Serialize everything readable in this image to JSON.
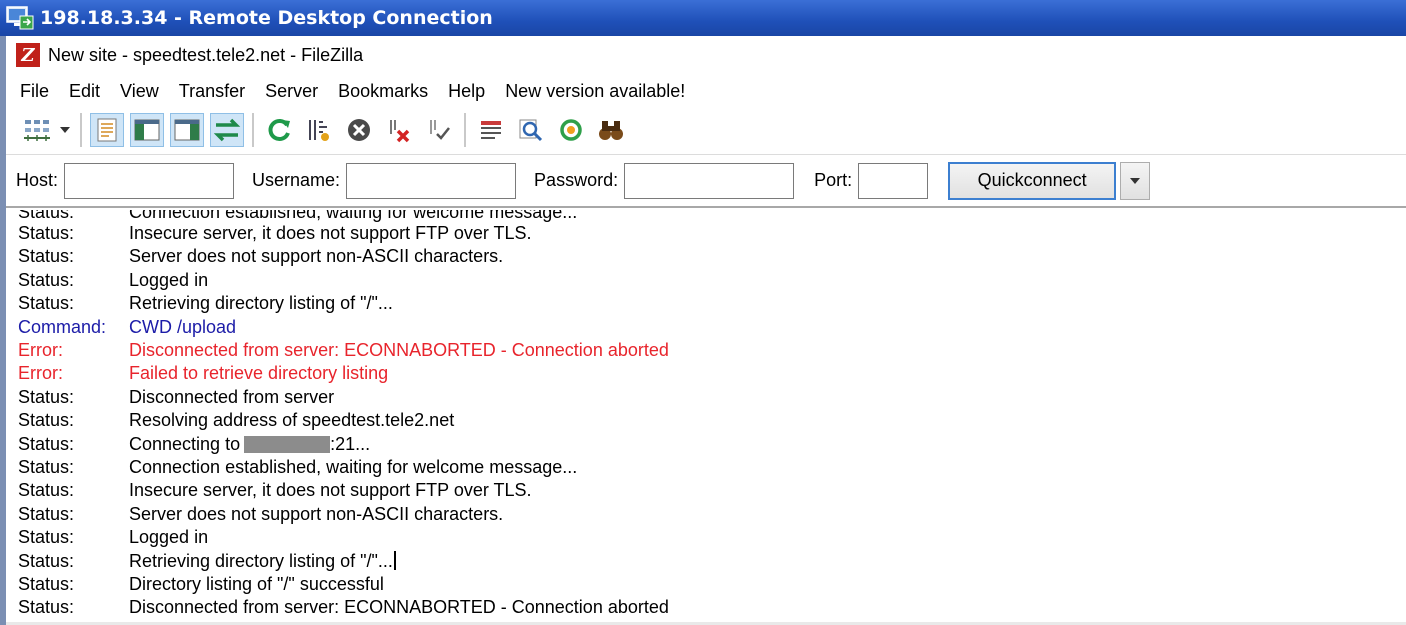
{
  "rdp": {
    "title": "198.18.3.34 - Remote Desktop Connection"
  },
  "filezilla": {
    "title": "New site - speedtest.tele2.net - FileZilla"
  },
  "menu": [
    "File",
    "Edit",
    "View",
    "Transfer",
    "Server",
    "Bookmarks",
    "Help",
    "New version available!"
  ],
  "quickconnect": {
    "host_label": "Host:",
    "host_value": "",
    "username_label": "Username:",
    "username_value": "",
    "password_label": "Password:",
    "password_value": "",
    "port_label": "Port:",
    "port_value": "",
    "button_label": "Quickconnect"
  },
  "log": {
    "colors": {
      "status": "#000000",
      "command": "#1c1ca8",
      "error": "#e8242c"
    },
    "partial_row": {
      "kind": "Status:",
      "message": "Connection established, waiting for welcome message..."
    },
    "rows": [
      {
        "kind": "Status:",
        "message": "Insecure server, it does not support FTP over TLS.",
        "type": "status"
      },
      {
        "kind": "Status:",
        "message": "Server does not support non-ASCII characters.",
        "type": "status"
      },
      {
        "kind": "Status:",
        "message": "Logged in",
        "type": "status"
      },
      {
        "kind": "Status:",
        "message": "Retrieving directory listing of \"/\"...",
        "type": "status"
      },
      {
        "kind": "Command:",
        "message": "CWD /upload",
        "type": "command"
      },
      {
        "kind": "Error:",
        "message": "Disconnected from server: ECONNABORTED - Connection aborted",
        "type": "error"
      },
      {
        "kind": "Error:",
        "message": "Failed to retrieve directory listing",
        "type": "error"
      },
      {
        "kind": "Status:",
        "message": "Disconnected from server",
        "type": "status"
      },
      {
        "kind": "Status:",
        "message": "Resolving address of speedtest.tele2.net",
        "type": "status"
      },
      {
        "kind": "Status:",
        "message": "Connecting to",
        "suffix": ":21...",
        "type": "status",
        "redacted": true
      },
      {
        "kind": "Status:",
        "message": "Connection established, waiting for welcome message...",
        "type": "status"
      },
      {
        "kind": "Status:",
        "message": "Insecure server, it does not support FTP over TLS.",
        "type": "status"
      },
      {
        "kind": "Status:",
        "message": "Server does not support non-ASCII characters.",
        "type": "status"
      },
      {
        "kind": "Status:",
        "message": "Logged in",
        "type": "status"
      },
      {
        "kind": "Status:",
        "message": "Retrieving directory listing of \"/\"...",
        "type": "status",
        "cursor": true
      },
      {
        "kind": "Status:",
        "message": "Directory listing of \"/\" successful",
        "type": "status"
      },
      {
        "kind": "Status:",
        "message": "Disconnected from server: ECONNABORTED - Connection aborted",
        "type": "status"
      }
    ]
  }
}
